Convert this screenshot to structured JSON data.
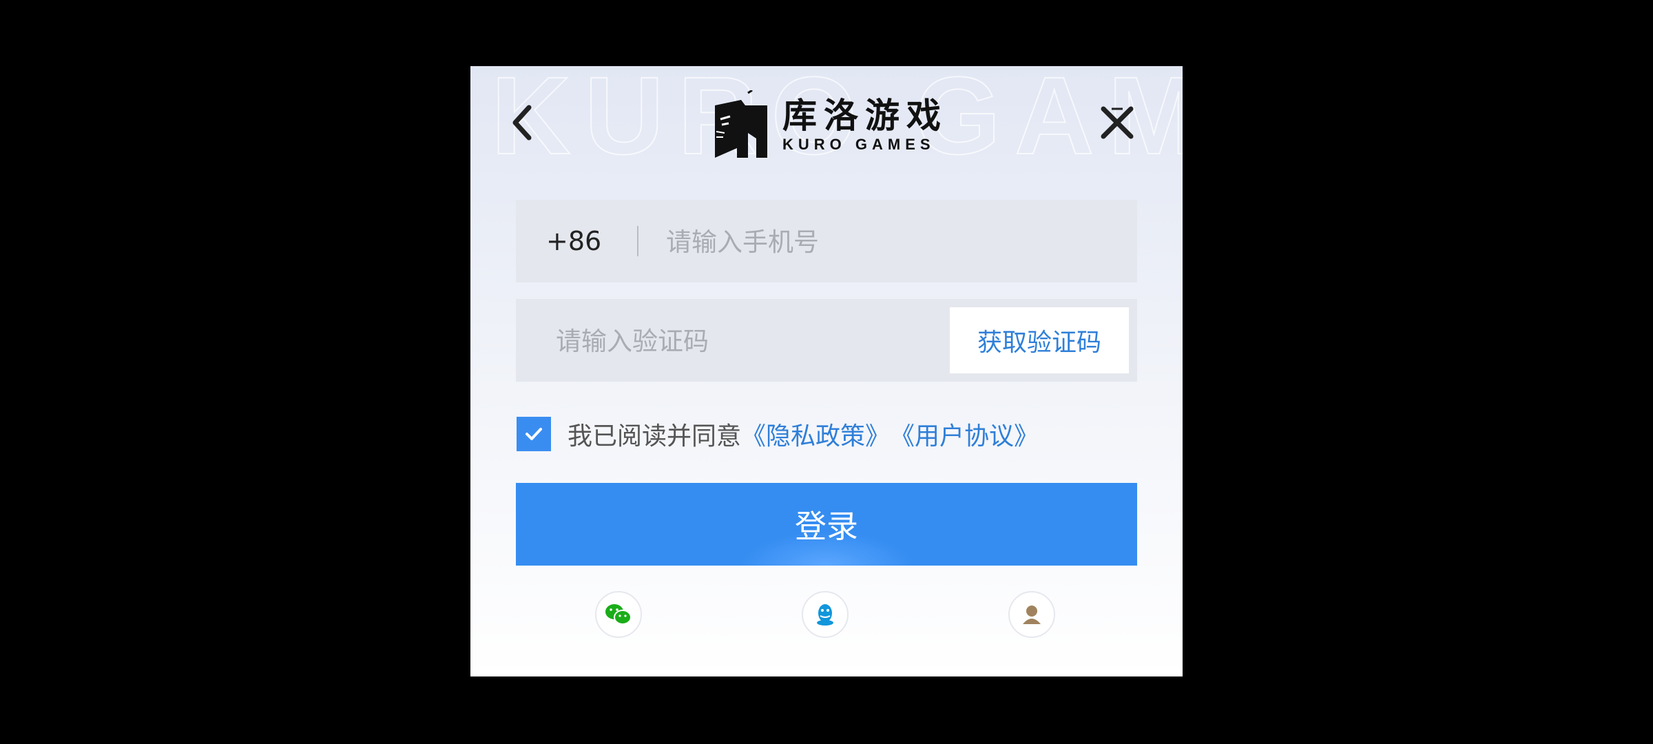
{
  "colors": {
    "accent": "#358df1",
    "link": "#2f7fd8",
    "checkbox": "#3a8df0",
    "wechat": "#1aad19",
    "qq": "#1296db",
    "guest": "#a0835e"
  },
  "header": {
    "back_icon": "chevron-left-icon",
    "close_icon": "close-icon",
    "logo": {
      "cn": "库洛游戏",
      "en": "KURO GAMES"
    }
  },
  "phone": {
    "prefix": "+86",
    "placeholder": "请输入手机号",
    "value": ""
  },
  "code": {
    "placeholder": "请输入验证码",
    "value": "",
    "get_code_label": "获取验证码"
  },
  "agreement": {
    "checked": true,
    "text": "我已阅读并同意",
    "privacy_link": "《隐私政策》",
    "user_link": "《用户协议》"
  },
  "login_label": "登录",
  "social": [
    {
      "icon": "wechat-icon"
    },
    {
      "icon": "qq-icon"
    },
    {
      "icon": "guest-icon"
    }
  ]
}
